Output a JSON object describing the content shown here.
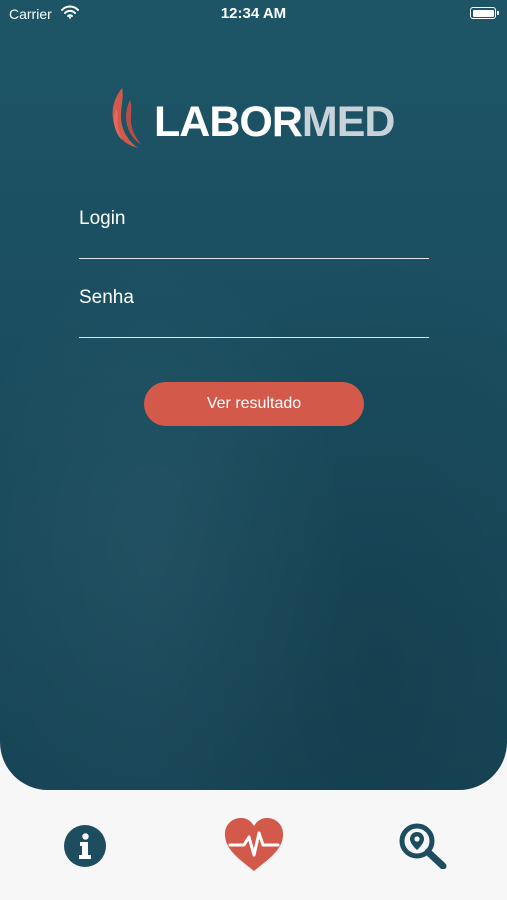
{
  "status_bar": {
    "carrier": "Carrier",
    "time": "12:34 AM",
    "wifi_icon": "wifi-icon",
    "battery_icon": "battery-icon"
  },
  "brand": {
    "name_part1": "LABOR",
    "name_part2": "MED",
    "mark_color": "#d35a4a"
  },
  "form": {
    "login_placeholder": "Login",
    "senha_placeholder": "Senha",
    "submit_label": "Ver resultado"
  },
  "tab_bar": {
    "items": [
      {
        "icon": "info-icon"
      },
      {
        "icon": "heart-pulse-icon"
      },
      {
        "icon": "location-search-icon"
      }
    ]
  },
  "colors": {
    "background_teal": "#1a4d5f",
    "accent_coral": "#d35a4a",
    "tab_icon_dark": "#1d4d5e",
    "tab_bar_background": "#f7f7f7"
  }
}
